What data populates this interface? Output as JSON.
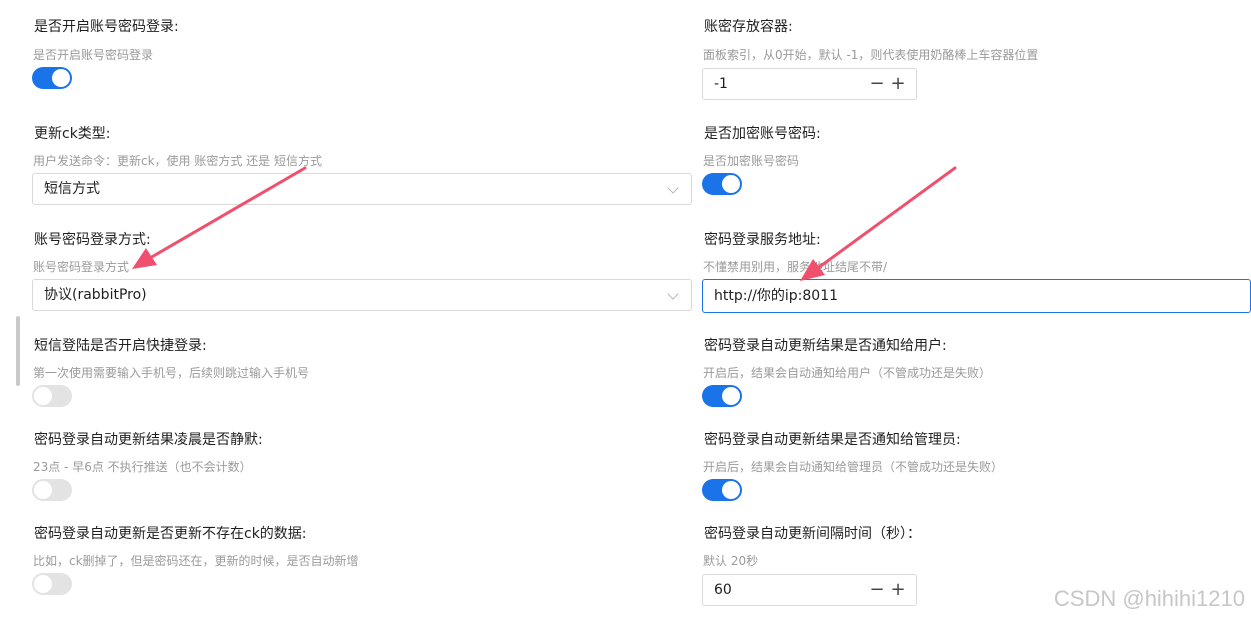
{
  "left": {
    "account_login": {
      "label": "是否开启账号密码登录:",
      "help": "是否开启账号密码登录",
      "enabled": true
    },
    "update_ck_type": {
      "label": "更新ck类型:",
      "help": "用户发送命令：更新ck，使用 账密方式 还是 短信方式",
      "value": "短信方式"
    },
    "login_method": {
      "label": "账号密码登录方式:",
      "help": "账号密码登录方式",
      "value": "协议(rabbitPro)"
    },
    "sms_quick_login": {
      "label": "短信登陆是否开启快捷登录:",
      "help": "第一次使用需要输入手机号，后续则跳过输入手机号",
      "enabled": false
    },
    "silent_night": {
      "label": "密码登录自动更新结果凌晨是否静默:",
      "help": "23点 - 早6点 不执行推送（也不会计数）",
      "enabled": false
    },
    "update_missing_ck": {
      "label": "密码登录自动更新是否更新不存在ck的数据:",
      "help": "比如，ck删掉了，但是密码还在，更新的时候，是否自动新增",
      "enabled": false
    }
  },
  "right": {
    "container": {
      "label": "账密存放容器:",
      "help": "面板索引，从0开始，默认 -1，则代表使用奶酪棒上车容器位置",
      "value": "-1"
    },
    "encrypt_password": {
      "label": "是否加密账号密码:",
      "help": "是否加密账号密码",
      "enabled": true
    },
    "service_url": {
      "label": "密码登录服务地址:",
      "help": "不懂禁用别用，服务地址结尾不带/",
      "value": "http://你的ip:8011"
    },
    "notify_user": {
      "label": "密码登录自动更新结果是否通知给用户:",
      "help": "开启后，结果会自动通知给用户（不管成功还是失败）",
      "enabled": true
    },
    "notify_admin": {
      "label": "密码登录自动更新结果是否通知给管理员:",
      "help": "开启后，结果会自动通知给管理员（不管成功还是失败）",
      "enabled": true
    },
    "interval": {
      "label": "密码登录自动更新间隔时间（秒）：",
      "help": "默认 20秒",
      "value": "60"
    }
  },
  "stepper": {
    "minus": "−",
    "plus": "+"
  },
  "watermark": "CSDN @hihihi1210",
  "colors": {
    "accent": "#1a73e8",
    "arrow": "#f0506e",
    "switch_off": "#e3e3e3"
  }
}
